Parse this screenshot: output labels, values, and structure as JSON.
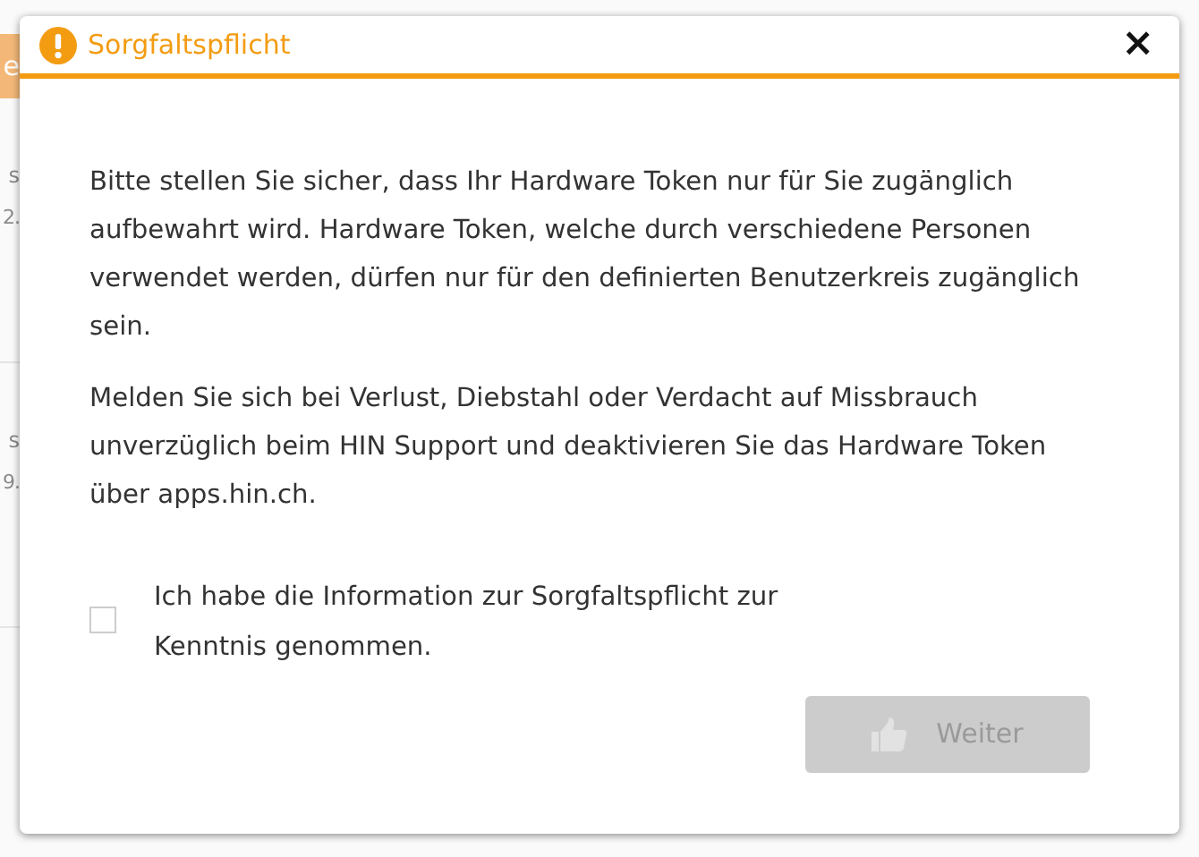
{
  "background": {
    "button_text": "e",
    "rows": [
      {
        "label": "s",
        "value": "2."
      },
      {
        "label": "s",
        "value": "9."
      }
    ]
  },
  "dialog": {
    "title": "Sorgfaltspflicht",
    "close": "×",
    "paragraphs": [
      "Bitte stellen Sie sicher, dass Ihr Hardware Token nur für Sie zugänglich aufbewahrt wird. Hardware Token, welche durch verschiedene Personen verwendet werden, dürfen nur für den definierten Benutzerkreis zugänglich sein.",
      "Melden Sie sich bei Verlust, Diebstahl oder Verdacht auf Missbrauch unverzüglich beim HIN Support und deaktivieren Sie das Hardware Token über apps.hin.ch."
    ],
    "confirm": {
      "label": "Ich habe die Information zur Sorgfaltspflicht zur Kenntnis genommen.",
      "checked": false
    },
    "button": {
      "label": "Weiter",
      "disabled": true
    }
  }
}
